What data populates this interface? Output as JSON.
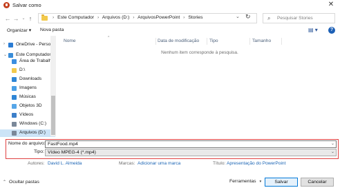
{
  "window": {
    "title": "Salvar como",
    "close_symbol": "✕"
  },
  "nav": {
    "back": "←",
    "forward": "→",
    "up_dropdown": "⌄",
    "up": "↑",
    "breadcrumb": [
      "Este Computador",
      "Arquivos (D:)",
      "ArquivosPowerPoint",
      "Stories"
    ],
    "separator": "›",
    "address_dropdown": "⌄",
    "refresh": "↻",
    "search_icon": "⌕",
    "search_placeholder": "Pesquisar Stories"
  },
  "toolbar": {
    "organize": "Organizar ▾",
    "new_folder": "Nova pasta",
    "view_icon": "▤ ▾",
    "help": "?"
  },
  "sidebar": {
    "items": [
      {
        "label": "OneDrive - Persor",
        "icon": "onedrive-icon",
        "color": "#2b7cd3",
        "indent": 1,
        "expander": "›"
      },
      {
        "label": "Este Computador",
        "icon": "computer-icon",
        "color": "#3a8dd8",
        "indent": 1,
        "expander": "⌄"
      },
      {
        "label": "Área de Trabalho",
        "icon": "desktop-icon",
        "color": "#3b8ee0",
        "indent": 2,
        "expander": ""
      },
      {
        "label": "D:\\",
        "icon": "folder-icon",
        "color": "#f2c94c",
        "indent": 2,
        "expander": ""
      },
      {
        "label": "Downloads",
        "icon": "downloads-icon",
        "color": "#2f86d6",
        "indent": 2,
        "expander": ""
      },
      {
        "label": "Imagens",
        "icon": "pictures-icon",
        "color": "#4aa0e6",
        "indent": 2,
        "expander": ""
      },
      {
        "label": "Músicas",
        "icon": "music-icon",
        "color": "#2f86d6",
        "indent": 2,
        "expander": ""
      },
      {
        "label": "Objetos 3D",
        "icon": "objects-3d-icon",
        "color": "#56a6e8",
        "indent": 2,
        "expander": ""
      },
      {
        "label": "Vídeos",
        "icon": "videos-icon",
        "color": "#3c7fc9",
        "indent": 2,
        "expander": ""
      },
      {
        "label": "Windows (C:)",
        "icon": "drive-icon",
        "color": "#7a8899",
        "indent": 2,
        "expander": ""
      },
      {
        "label": "Arquivos (D:)",
        "icon": "drive-icon",
        "color": "#7a8899",
        "indent": 2,
        "expander": "",
        "selected": true
      }
    ]
  },
  "content": {
    "columns": [
      "Nome",
      "Data de modificação",
      "Tipo",
      "Tamanho"
    ],
    "sort_indicator": "^",
    "empty_message": "Nenhum item corresponde à pesquisa."
  },
  "fields": {
    "filename_label": "Nome do arquivo:",
    "filename_value": "FastFood.mp4",
    "type_label": "Tipo:",
    "type_value": "Vídeo MPEG-4 (*.mp4)",
    "dropdown_caret": "⌄"
  },
  "metadata": {
    "authors_label": "Autores:",
    "authors_value": "David L. Almeida",
    "tags_label": "Marcas:",
    "tags_value": "Adicionar uma marca",
    "title_label": "Título:",
    "title_value": "Apresentação do PowerPoint"
  },
  "footer": {
    "hide_folders": "Ocultar pastas",
    "hide_chevron": "⌃",
    "tools": "Ferramentas",
    "tools_chevron": "▾",
    "save": "Salvar",
    "cancel": "Cancelar"
  },
  "colors": {
    "highlight_border": "#e04040",
    "link": "#1a64b4",
    "primary_button_border": "#0078d7",
    "selected_nav": "#cce4f7"
  }
}
